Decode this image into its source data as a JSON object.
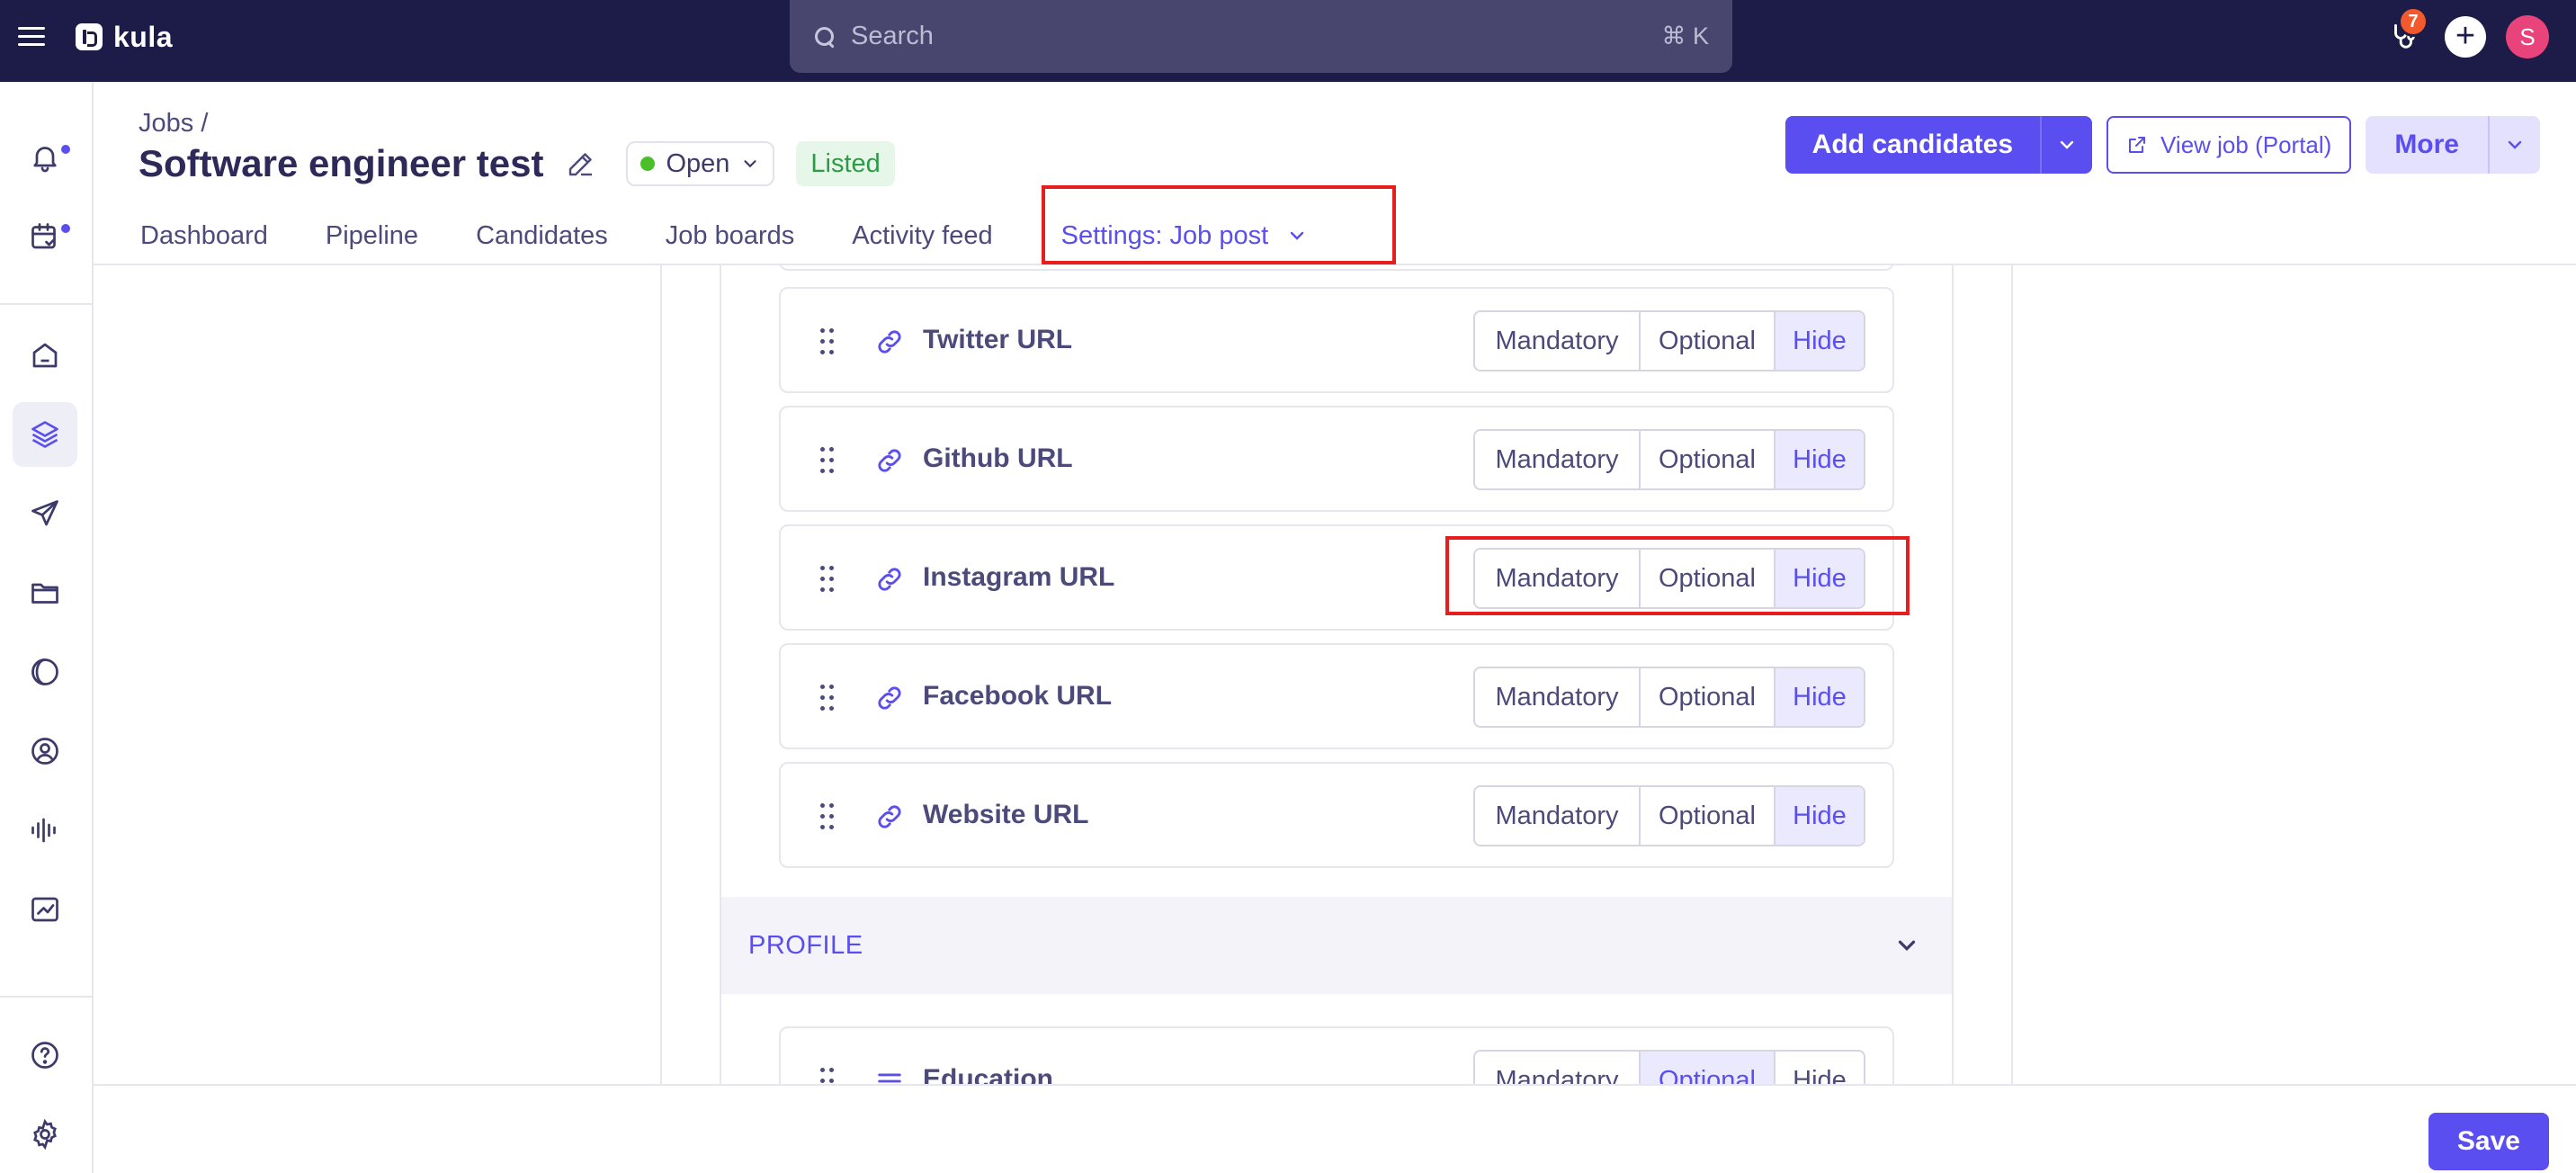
{
  "app": {
    "brand": "kula",
    "accent": "#5b4ef0",
    "nav_bg": "#1d1b47"
  },
  "topbar": {
    "search_placeholder": "Search",
    "search_shortcut": "⌘ K",
    "notification_count": "7",
    "avatar_initial": "S"
  },
  "sidebar": {
    "items": [
      "bell-icon",
      "calendar-check-icon",
      "home-icon",
      "layers-icon",
      "send-icon",
      "folder-icon",
      "moon-icon",
      "user-circle-icon",
      "audio-wave-icon",
      "chart-icon",
      "help-icon",
      "settings-icon"
    ],
    "active": "layers-icon"
  },
  "header": {
    "breadcrumb": "Jobs /",
    "title": "Software engineer test",
    "status": "Open",
    "status_color": "#4bbf2a",
    "badge": "Listed",
    "actions": {
      "add_candidates": "Add candidates",
      "view_job": "View job (Portal)",
      "more": "More"
    },
    "tabs": [
      {
        "label": "Dashboard"
      },
      {
        "label": "Pipeline"
      },
      {
        "label": "Candidates"
      },
      {
        "label": "Job boards"
      },
      {
        "label": "Activity feed"
      },
      {
        "label": "Settings: Job post",
        "active": true
      }
    ]
  },
  "options": {
    "mandatory": "Mandatory",
    "optional": "Optional",
    "hide": "Hide"
  },
  "fields": [
    {
      "label": "Twitter URL",
      "selected": "Hide"
    },
    {
      "label": "Github URL",
      "selected": "Hide"
    },
    {
      "label": "Instagram URL",
      "selected": "Hide"
    },
    {
      "label": "Facebook URL",
      "selected": "Hide"
    },
    {
      "label": "Website URL",
      "selected": "Hide"
    }
  ],
  "profile_section": {
    "title": "PROFILE",
    "fields": [
      {
        "label": "Education",
        "selected": "Optional"
      }
    ]
  },
  "footer": {
    "save": "Save"
  },
  "highlight_color": "#e61e1e"
}
